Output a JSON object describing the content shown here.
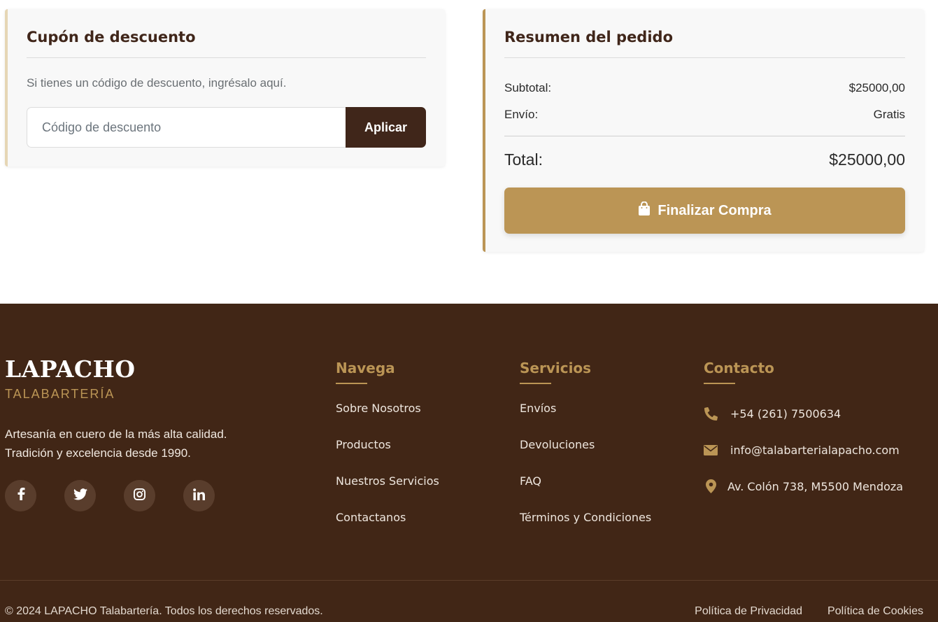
{
  "coupon": {
    "title": "Cupón de descuento",
    "description": "Si tienes un código de descuento, ingrésalo aquí.",
    "input_placeholder": "Código de descuento",
    "input_value": "",
    "apply_label": "Aplicar"
  },
  "summary": {
    "title": "Resumen del pedido",
    "subtotal_label": "Subtotal:",
    "subtotal_value": "$25000,00",
    "shipping_label": "Envío:",
    "shipping_value": "Gratis",
    "total_label": "Total:",
    "total_value": "$25000,00",
    "checkout_label": "Finalizar Compra",
    "checkout_icon": "shopping-bag-icon"
  },
  "footer": {
    "brand": "LAPACHO",
    "brand_sub": "TALABARTERÍA",
    "tagline_line1": "Artesanía en cuero de la más alta calidad.",
    "tagline_line2": "Tradición y excelencia desde 1990.",
    "socials": [
      "facebook-icon",
      "twitter-icon",
      "instagram-icon",
      "linkedin-icon"
    ],
    "navega": {
      "title": "Navega",
      "links": [
        "Sobre Nosotros",
        "Productos",
        "Nuestros Servicios",
        "Contactanos"
      ]
    },
    "servicios": {
      "title": "Servicios",
      "links": [
        "Envíos",
        "Devoluciones",
        "FAQ",
        "Términos y Condiciones"
      ]
    },
    "contacto": {
      "title": "Contacto",
      "phone": "+54 (261) 7500634",
      "email": "info@talabarterialapacho.com",
      "address": "Av. Colón 738, M5500 Mendoza"
    },
    "copyright": "© 2024 LAPACHO Talabartería. Todos los derechos reservados.",
    "privacy": "Política de Privacidad",
    "cookies": "Política de Cookies"
  },
  "colors": {
    "brown": "#40261a",
    "gold": "#bb9555",
    "footer_bg": "#412616"
  }
}
